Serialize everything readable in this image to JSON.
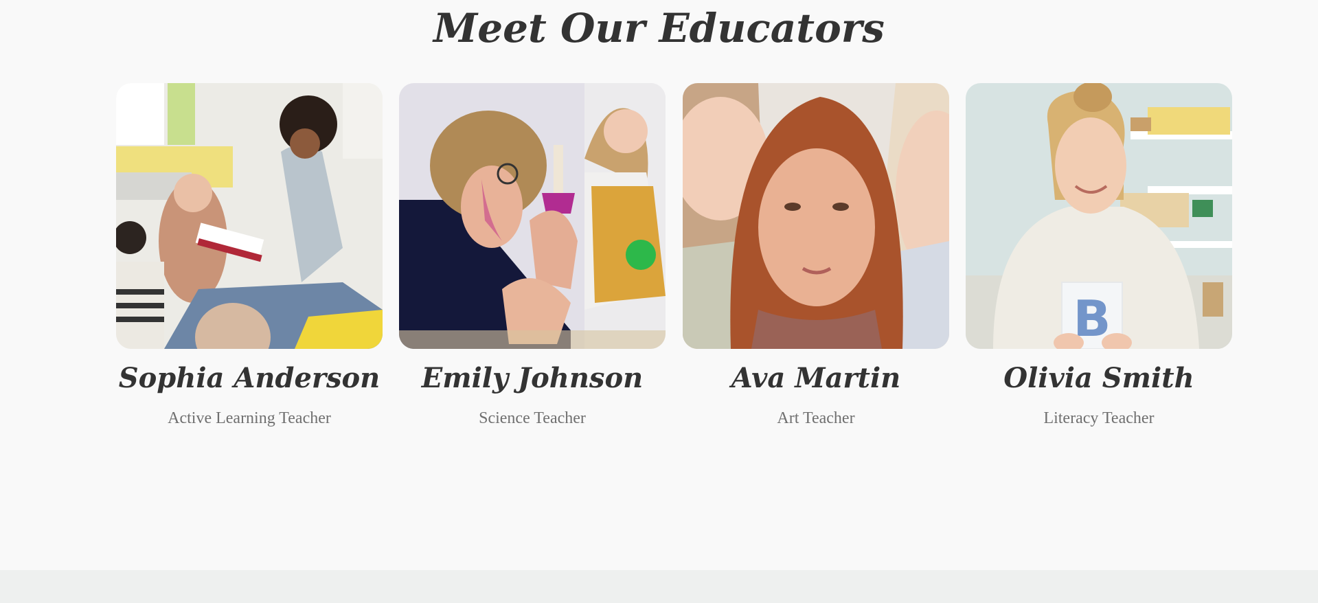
{
  "section": {
    "title": "Meet Our Educators"
  },
  "educators": [
    {
      "name": "Sophia Anderson",
      "role": "Active Learning Teacher",
      "photo_alt": "Teacher reading a book to children"
    },
    {
      "name": "Emily Johnson",
      "role": "Science Teacher",
      "photo_alt": "Teacher holding a bell with a child"
    },
    {
      "name": "Ava Martin",
      "role": "Art Teacher",
      "photo_alt": "Teacher looking down with children"
    },
    {
      "name": "Olivia Smith",
      "role": "Literacy Teacher",
      "photo_alt": "Teacher holding a letter card"
    }
  ],
  "photo_card_letter": "B",
  "colors": {
    "background": "#f9f9f9",
    "heading": "#333333",
    "subtext": "#6f6f6f",
    "footer": "#eef0ef"
  }
}
